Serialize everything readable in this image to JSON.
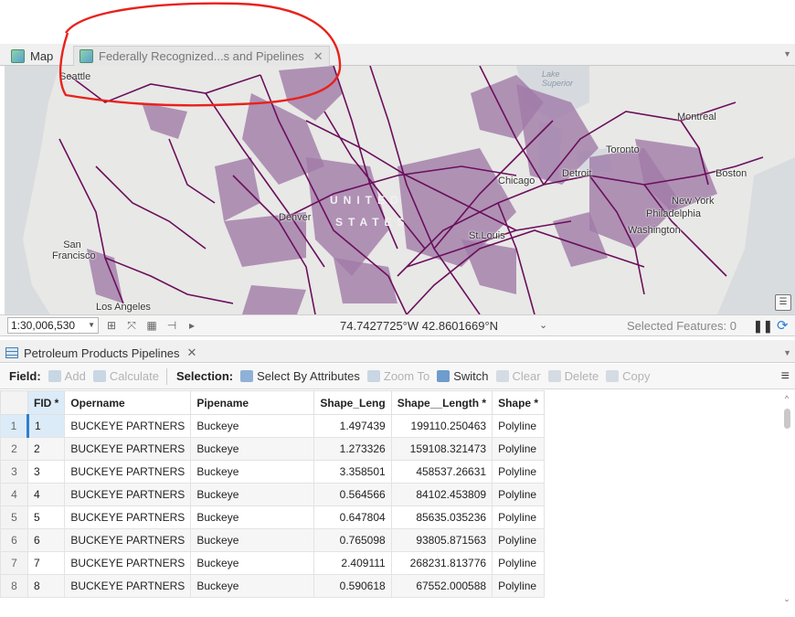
{
  "map_tabs": [
    {
      "label": "Map"
    },
    {
      "label": "Federally Recognized...s and Pipelines"
    }
  ],
  "map": {
    "cities": [
      "Seattle",
      "Montreal",
      "Toronto",
      "Boston",
      "Detroit",
      "Chicago",
      "New York",
      "Philadelphia",
      "Washington",
      "St.Louis",
      "Denver",
      "San Francisco",
      "Los Angeles"
    ],
    "lake_superior": "Lake Superior",
    "country": [
      "UNITED",
      "STATES"
    ]
  },
  "statusbar": {
    "scale": "1:30,006,530",
    "coords": "74.7427725°W 42.8601669°N",
    "selected_features": "Selected Features: 0"
  },
  "table_tab": {
    "label": "Petroleum Products Pipelines"
  },
  "toolbar": {
    "field_label": "Field:",
    "add": "Add",
    "calculate": "Calculate",
    "selection_label": "Selection:",
    "select_by_attributes": "Select By Attributes",
    "zoom_to": "Zoom To",
    "switch": "Switch",
    "clear": "Clear",
    "delete": "Delete",
    "copy": "Copy"
  },
  "table": {
    "columns": [
      "FID *",
      "Opername",
      "Pipename",
      "Shape_Leng",
      "Shape__Length *",
      "Shape *"
    ],
    "rows": [
      [
        "1",
        "1",
        "BUCKEYE PARTNERS",
        "Buckeye",
        "1.497439",
        "199110.250463",
        "Polyline"
      ],
      [
        "2",
        "2",
        "BUCKEYE PARTNERS",
        "Buckeye",
        "1.273326",
        "159108.321473",
        "Polyline"
      ],
      [
        "3",
        "3",
        "BUCKEYE PARTNERS",
        "Buckeye",
        "3.358501",
        "458537.26631",
        "Polyline"
      ],
      [
        "4",
        "4",
        "BUCKEYE PARTNERS",
        "Buckeye",
        "0.564566",
        "84102.453809",
        "Polyline"
      ],
      [
        "5",
        "5",
        "BUCKEYE PARTNERS",
        "Buckeye",
        "0.647804",
        "85635.035236",
        "Polyline"
      ],
      [
        "6",
        "6",
        "BUCKEYE PARTNERS",
        "Buckeye",
        "0.765098",
        "93805.871563",
        "Polyline"
      ],
      [
        "7",
        "7",
        "BUCKEYE PARTNERS",
        "Buckeye",
        "2.409111",
        "268231.813776",
        "Polyline"
      ],
      [
        "8",
        "8",
        "BUCKEYE PARTNERS",
        "Buckeye",
        "0.590618",
        "67552.000588",
        "Polyline"
      ]
    ]
  },
  "colors": {
    "pipeline": "#6a0f5c",
    "tribal_area": "#a07aa8",
    "annotation": "#e8221c",
    "accent": "#2f7fd0"
  }
}
